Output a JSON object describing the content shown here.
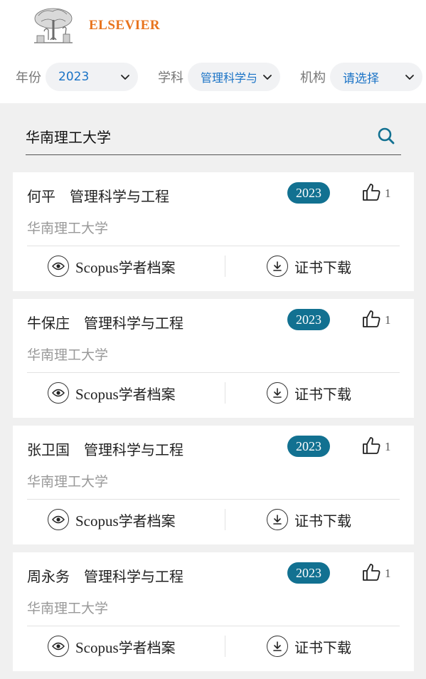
{
  "brand": {
    "name": "ELSEVIER"
  },
  "filters": {
    "year": {
      "label": "年份",
      "value": "2023"
    },
    "subject": {
      "label": "学科",
      "value": "管理科学与工"
    },
    "institution": {
      "label": "机构",
      "value": "请选择"
    }
  },
  "search": {
    "value": "华南理工大学"
  },
  "colors": {
    "accent": "#127191",
    "brand": "#e8731c",
    "link": "#1a73c6"
  },
  "cards": [
    {
      "name": "何平",
      "subject": "管理科学与工程",
      "year": "2023",
      "likes": "1",
      "institution": "华南理工大学",
      "profile_label_latin": "Scopus",
      "profile_label_cn": "学者档案",
      "download_label": "证书下载"
    },
    {
      "name": "牛保庄",
      "subject": "管理科学与工程",
      "year": "2023",
      "likes": "1",
      "institution": "华南理工大学",
      "profile_label_latin": "Scopus",
      "profile_label_cn": "学者档案",
      "download_label": "证书下载"
    },
    {
      "name": "张卫国",
      "subject": "管理科学与工程",
      "year": "2023",
      "likes": "1",
      "institution": "华南理工大学",
      "profile_label_latin": "Scopus",
      "profile_label_cn": "学者档案",
      "download_label": "证书下载"
    },
    {
      "name": "周永务",
      "subject": "管理科学与工程",
      "year": "2023",
      "likes": "1",
      "institution": "华南理工大学",
      "profile_label_latin": "Scopus",
      "profile_label_cn": "学者档案",
      "download_label": "证书下载"
    }
  ]
}
